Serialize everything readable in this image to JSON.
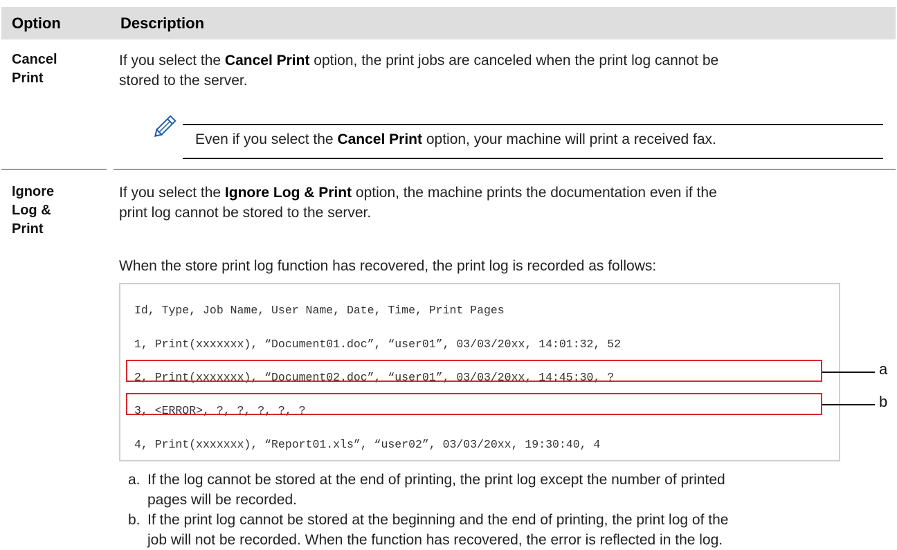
{
  "header": {
    "option": "Option",
    "description": "Description"
  },
  "rows": [
    {
      "option_line1": "Cancel",
      "option_line2": "Print",
      "text_before": "If you select the ",
      "text_bold": "Cancel Print",
      "text_after_line1": " option, the print jobs are canceled when the print log cannot be",
      "text_line2": "stored to the server.",
      "note": {
        "icon": "pencil-icon",
        "before": "Even if you select the ",
        "bold": "Cancel Print",
        "after": " option, your machine will print a received fax."
      }
    },
    {
      "option_line1": "Ignore",
      "option_line2": "Log &",
      "option_line3": "Print",
      "text_before": "If you select the ",
      "text_bold": "Ignore Log & Print",
      "text_after_line1": " option, the machine prints the documentation even if the",
      "text_line2": "print log cannot be stored to the server.",
      "text_recovered": "When the store print log function has recovered, the print log is recorded as follows:",
      "log_lines": [
        "Id, Type, Job Name, User Name, Date, Time, Print Pages",
        "1, Print(xxxxxxx), “Document01.doc”, “user01”, 03/03/20xx, 14:01:32, 52",
        "2, Print(xxxxxxx), “Document02.doc”, “user01”, 03/03/20xx, 14:45:30, ?",
        "3, <ERROR>, ?, ?, ?, ?, ?",
        "4, Print(xxxxxxx), “Report01.xls”, “user02”, 03/03/20xx, 19:30:40, 4"
      ],
      "callouts": [
        "a",
        "b"
      ],
      "list": [
        {
          "label": "a.",
          "line1": "If the log cannot be stored at the end of printing, the print log except the number of printed",
          "line2": "pages will be recorded."
        },
        {
          "label": "b.",
          "line1": "If the print log cannot be stored at the beginning and the end of printing, the print log of the",
          "line2": "job will not be recorded. When the function has recovered, the error is reflected in the log."
        }
      ]
    }
  ],
  "colors": {
    "header_bg": "#dedede",
    "highlight_red": "#d9262d",
    "note_icon_blue": "#1f5fa8"
  }
}
